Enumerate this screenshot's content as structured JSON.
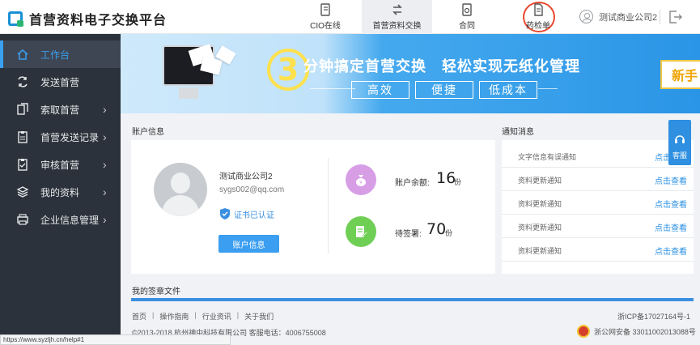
{
  "app": {
    "title": "首营资料电子交换平台"
  },
  "topnav": {
    "cio": "CIO在线",
    "exchange": "首营资料交换",
    "contract": "合同",
    "drug_report": "药检单"
  },
  "user": {
    "name": "测试商业公司2"
  },
  "sidebar": {
    "items": [
      {
        "label": "工作台",
        "icon": "home-icon",
        "active": true
      },
      {
        "label": "发送首营",
        "icon": "send-icon"
      },
      {
        "label": "索取首营",
        "icon": "copy-icon",
        "arrow": "›"
      },
      {
        "label": "首营发送记录",
        "icon": "clipboard-icon",
        "arrow": "›"
      },
      {
        "label": "审核首营",
        "icon": "clipboard-check-icon",
        "arrow": "›"
      },
      {
        "label": "我的资料",
        "icon": "layers-icon",
        "arrow": "›"
      },
      {
        "label": "企业信息管理",
        "icon": "printer-icon",
        "arrow": "›"
      }
    ]
  },
  "banner": {
    "number": "3",
    "headline": "分钟搞定首营交换　轻松实现无纸化管理",
    "tags": [
      "高效",
      "便捷",
      "低成本"
    ],
    "new_button": "新手"
  },
  "account": {
    "section_title": "账户信息",
    "company": "测试商业公司2",
    "email": "sygs002@qq.com",
    "cert_status": "证书已认证",
    "button": "账户信息",
    "balance_label": "账户余额:",
    "balance_value": "16",
    "balance_unit": "份",
    "pending_label": "待签署:",
    "pending_value": "70",
    "pending_unit": "份",
    "colors": {
      "balance_icon": "#d79ee6",
      "pending_icon": "#6fcf55",
      "accent": "#3b9ef0"
    }
  },
  "notice": {
    "section_title": "通知消息",
    "items": [
      {
        "text": "文字信息有误通知",
        "link": "点击查看"
      },
      {
        "text": "资料更新通知",
        "link": "点击查看"
      },
      {
        "text": "资料更新通知",
        "link": "点击查看"
      },
      {
        "text": "资料更新通知",
        "link": "点击查看"
      },
      {
        "text": "资料更新通知",
        "link": "点击查看"
      }
    ]
  },
  "kefu": {
    "label": "客服"
  },
  "signed": {
    "section_title": "我的签章文件"
  },
  "footer": {
    "links": [
      "首页",
      "操作指南",
      "行业资讯",
      "关于我们"
    ],
    "icp": "浙ICP备17027164号-1",
    "copyright": "©2013-2018 杭州神中科技有限公司 客服电话：4006755008",
    "police": "浙公网安备 33011002013088号"
  },
  "statusbar": {
    "url": "https://www.syzljh.cn/help#1"
  }
}
